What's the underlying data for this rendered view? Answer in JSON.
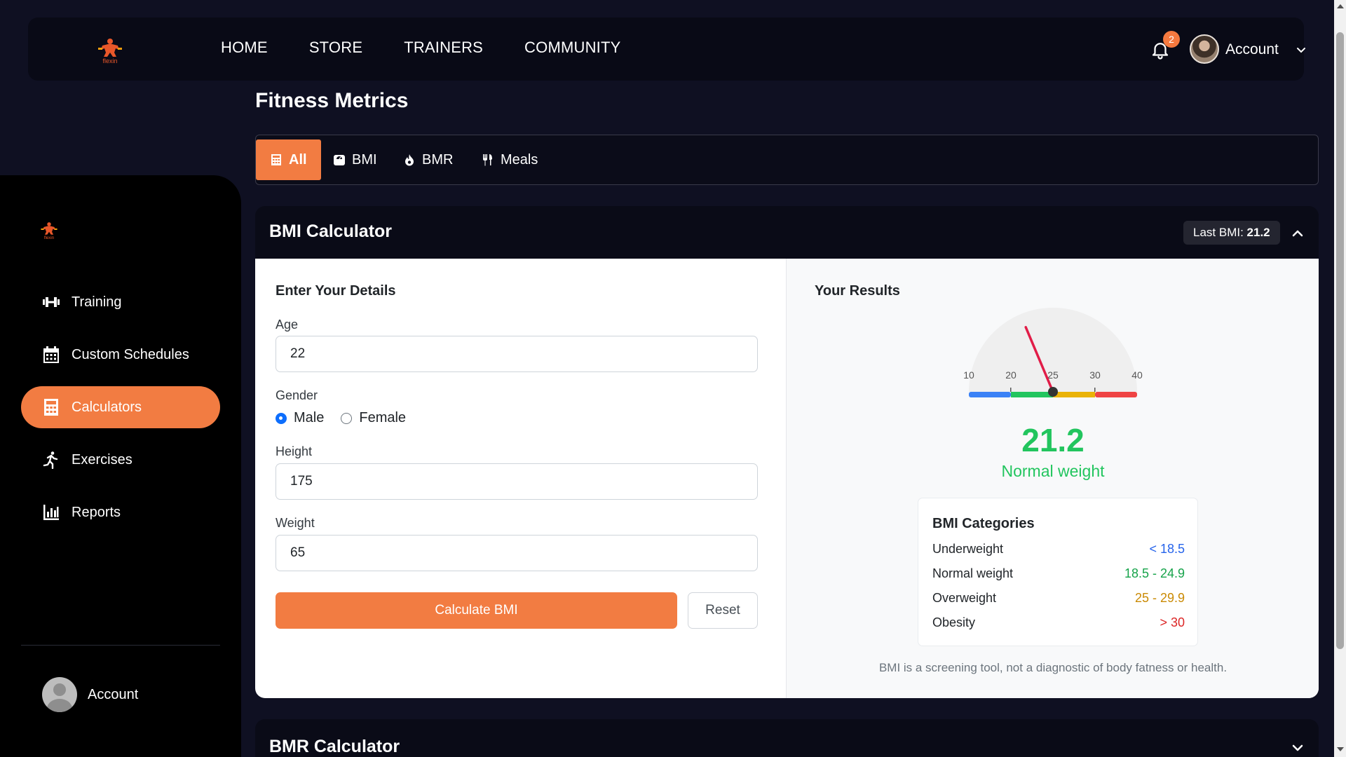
{
  "nav": {
    "items": [
      "HOME",
      "STORE",
      "TRAINERS",
      "COMMUNITY"
    ],
    "notification_count": "2",
    "account_label": "Account"
  },
  "sidebar": {
    "items": [
      {
        "label": "Training",
        "icon": "dumbbell-icon"
      },
      {
        "label": "Custom Schedules",
        "icon": "calendar-icon"
      },
      {
        "label": "Calculators",
        "icon": "calculator-icon"
      },
      {
        "label": "Exercises",
        "icon": "running-icon"
      },
      {
        "label": "Reports",
        "icon": "bar-chart-icon"
      }
    ],
    "active": "Calculators",
    "account_label": "Account"
  },
  "page": {
    "title": "Fitness Metrics",
    "tabs": [
      {
        "label": "All",
        "icon": "calculator-icon"
      },
      {
        "label": "BMI",
        "icon": "scale-icon"
      },
      {
        "label": "BMR",
        "icon": "fire-icon"
      },
      {
        "label": "Meals",
        "icon": "utensils-icon"
      }
    ],
    "active_tab": "All"
  },
  "bmi_card": {
    "title": "BMI Calculator",
    "last_bmi_label": "Last BMI:",
    "last_bmi_value": "21.2",
    "form": {
      "heading": "Enter Your Details",
      "age_label": "Age",
      "age_value": "22",
      "gender_label": "Gender",
      "gender_options": [
        "Male",
        "Female"
      ],
      "gender_selected": "Male",
      "height_label": "Height",
      "height_value": "175",
      "weight_label": "Weight",
      "weight_value": "65",
      "calculate_label": "Calculate BMI",
      "reset_label": "Reset"
    },
    "results": {
      "heading": "Your Results",
      "gauge_ticks": [
        "10",
        "20",
        "25",
        "30",
        "40"
      ],
      "gauge_value": 21.2,
      "bmi_value": "21.2",
      "status": "Normal weight",
      "status_color": "#22c55e",
      "categories_title": "BMI Categories",
      "categories": [
        {
          "name": "Underweight",
          "range": "< 18.5",
          "color": "#2563eb"
        },
        {
          "name": "Normal weight",
          "range": "18.5 - 24.9",
          "color": "#16a34a"
        },
        {
          "name": "Overweight",
          "range": "25 - 29.9",
          "color": "#ca8a04"
        },
        {
          "name": "Obesity",
          "range": "> 30",
          "color": "#dc2626"
        }
      ],
      "disclaimer": "BMI is a screening tool, not a diagnostic of body fatness or health."
    }
  },
  "bmr_card": {
    "title": "BMR Calculator"
  },
  "colors": {
    "accent": "#f27c42",
    "background": "#0f1022"
  }
}
